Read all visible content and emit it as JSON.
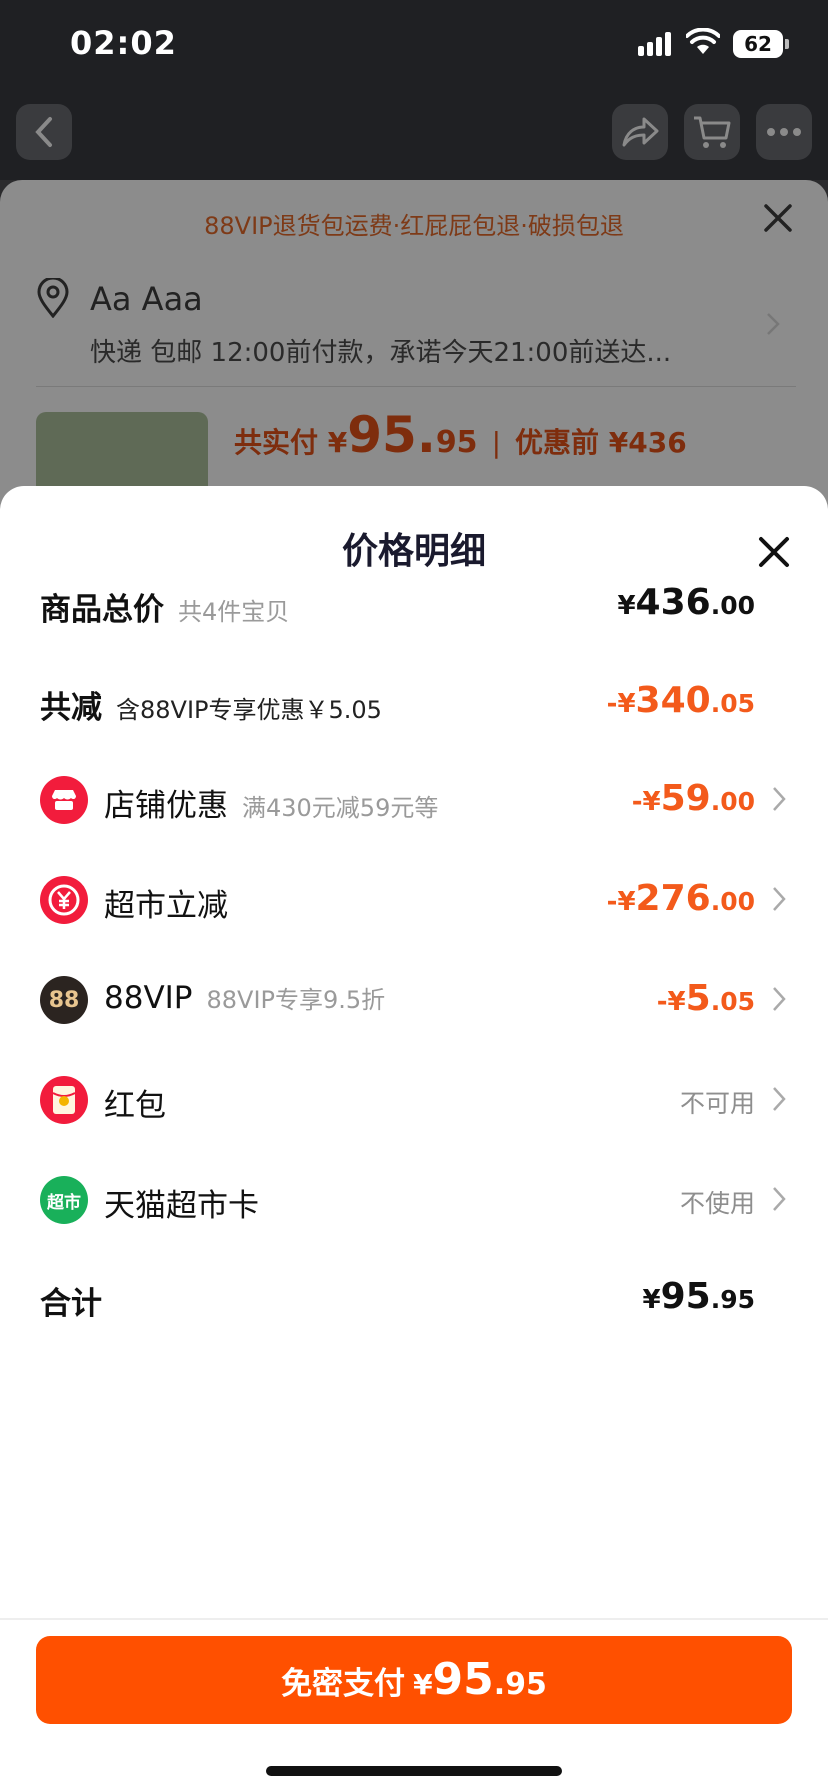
{
  "status_bar": {
    "time": "02:02",
    "battery": "62"
  },
  "background": {
    "banner": "88VIP退货包运费·红屁屁包退·破损包退",
    "address_name": "Aa Aaa",
    "shipping": "快递 包邮 12:00前付款，承诺今天21:00前送达...",
    "pay_label": "共实付 ¥",
    "pay_int": "95.",
    "pay_dec": "95",
    "pre_label": "优惠前 ¥436"
  },
  "sheet": {
    "title": "价格明细",
    "rows": {
      "total": {
        "label": "商品总价",
        "sub": "共4件宝贝",
        "cur": "¥",
        "int": "436",
        "dec": ".00"
      },
      "reduce": {
        "label": "共减",
        "sub": "含88VIP专享优惠￥5.05",
        "cur": "-¥",
        "int": "340",
        "dec": ".05"
      },
      "store": {
        "label": "店铺优惠",
        "sub": "满430元减59元等",
        "cur": "-¥",
        "int": "59",
        "dec": ".00"
      },
      "market": {
        "label": "超市立减",
        "cur": "-¥",
        "int": "276",
        "dec": ".00"
      },
      "vip": {
        "label": "88VIP",
        "sub": "88VIP专享9.5折",
        "icon_text": "88",
        "cur": "-¥",
        "int": "5",
        "dec": ".05"
      },
      "redpacket": {
        "label": "红包",
        "status": "不可用"
      },
      "card": {
        "label": "天猫超市卡",
        "icon_text": "超市",
        "status": "不使用"
      },
      "sum": {
        "label": "合计",
        "cur": "¥",
        "int": "95",
        "dec": ".95"
      }
    },
    "pay_button": {
      "label": "免密支付",
      "cur": "¥",
      "int": "95",
      "dec": ".95"
    }
  },
  "colors": {
    "accent": "#ff5000",
    "discount": "#f35a1b"
  }
}
